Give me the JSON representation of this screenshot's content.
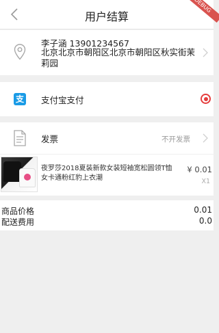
{
  "header": {
    "title": "用户结算",
    "debug_badge": "DEBUG"
  },
  "address": {
    "name_phone": "李子涵 13901234567",
    "detail": "北京北京市朝阳区北京市朝阳区秋实街茉莉园"
  },
  "payment": {
    "method_label": "支付宝支付",
    "icon_glyph": "支",
    "brand_color": "#1a9be6",
    "selected_color": "#e53c3c"
  },
  "invoice": {
    "label": "发票",
    "value": "不开发票"
  },
  "product": {
    "name": "夜罗莎2018夏装新款女装短袖宽松圆领T恤女卡通粉红豹上衣潮",
    "price": "¥ 0.01",
    "quantity": "X1"
  },
  "summary": {
    "goods_price_label": "商品价格",
    "goods_price_value": "0.01",
    "shipping_label": "配送费用",
    "shipping_value": "0.0"
  }
}
